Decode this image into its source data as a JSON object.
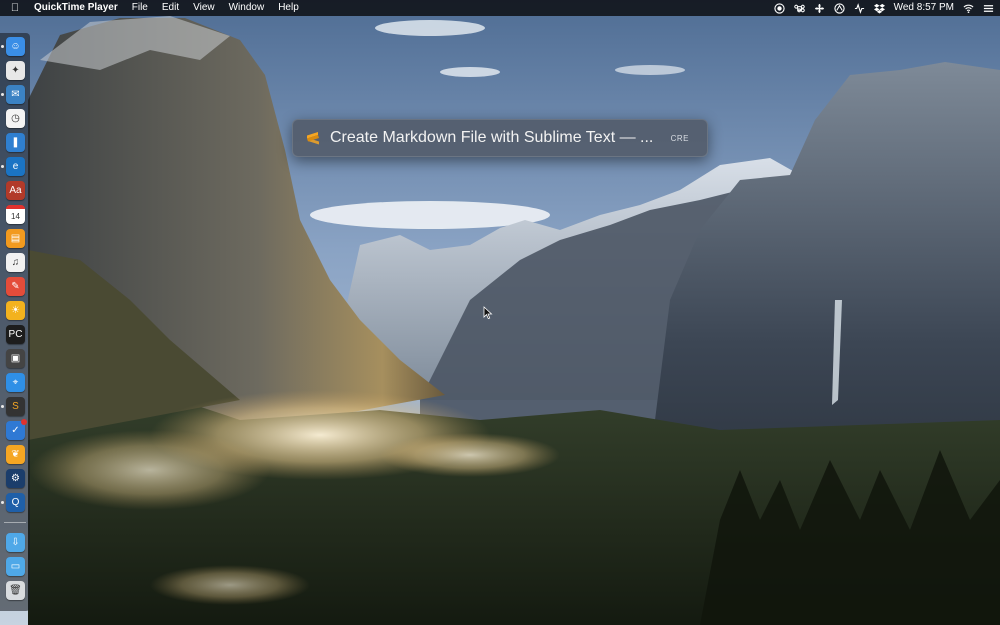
{
  "menubar": {
    "app_name": "QuickTime Player",
    "menus": [
      "File",
      "Edit",
      "View",
      "Window",
      "Help"
    ],
    "clock": "Wed 8:57 PM"
  },
  "command_bar": {
    "text": "Create Markdown File with Sublime Text — ...",
    "tag": "CRE"
  },
  "dock": {
    "icons": [
      {
        "name": "finder-icon",
        "color": "#3a8ee6"
      },
      {
        "name": "launchpad-icon",
        "color": "#e8e8e8"
      },
      {
        "name": "airmail-icon",
        "color": "#3b82c4"
      },
      {
        "name": "clock-icon",
        "color": "#f4f4f4"
      },
      {
        "name": "bookmark-icon",
        "color": "#2f7fd0"
      },
      {
        "name": "edge-icon",
        "color": "#1b74c4"
      },
      {
        "name": "dictionary-icon",
        "color": "#b23a2a"
      },
      {
        "name": "calendar-icon",
        "color": "#ffffff"
      },
      {
        "name": "books-icon",
        "color": "#f29a1f"
      },
      {
        "name": "itunes-icon",
        "color": "#f1f1f1"
      },
      {
        "name": "goodnotes-icon",
        "color": "#e44c3a"
      },
      {
        "name": "weather-icon",
        "color": "#f3b21e"
      },
      {
        "name": "pycharm-icon",
        "color": "#1d1d1d"
      },
      {
        "name": "box-icon",
        "color": "#444444"
      },
      {
        "name": "safari-icon",
        "color": "#2f8fe6"
      },
      {
        "name": "sublime-text-icon",
        "color": "#333333"
      },
      {
        "name": "things-icon",
        "color": "#2f79d4"
      },
      {
        "name": "tes-icon",
        "color": "#f5a623"
      },
      {
        "name": "steam-icon",
        "color": "#1b3d6b"
      },
      {
        "name": "quicktime-icon",
        "color": "#1f5fa8"
      },
      {
        "name": "downloads-folder-icon",
        "color": "#4fa8e8"
      },
      {
        "name": "documents-folder-icon",
        "color": "#4fa8e8"
      },
      {
        "name": "trash-icon",
        "color": "#d9dcdf"
      }
    ]
  },
  "colors": {
    "accent_sublime": "#f5a623",
    "notification_badge": "#e0322e"
  }
}
